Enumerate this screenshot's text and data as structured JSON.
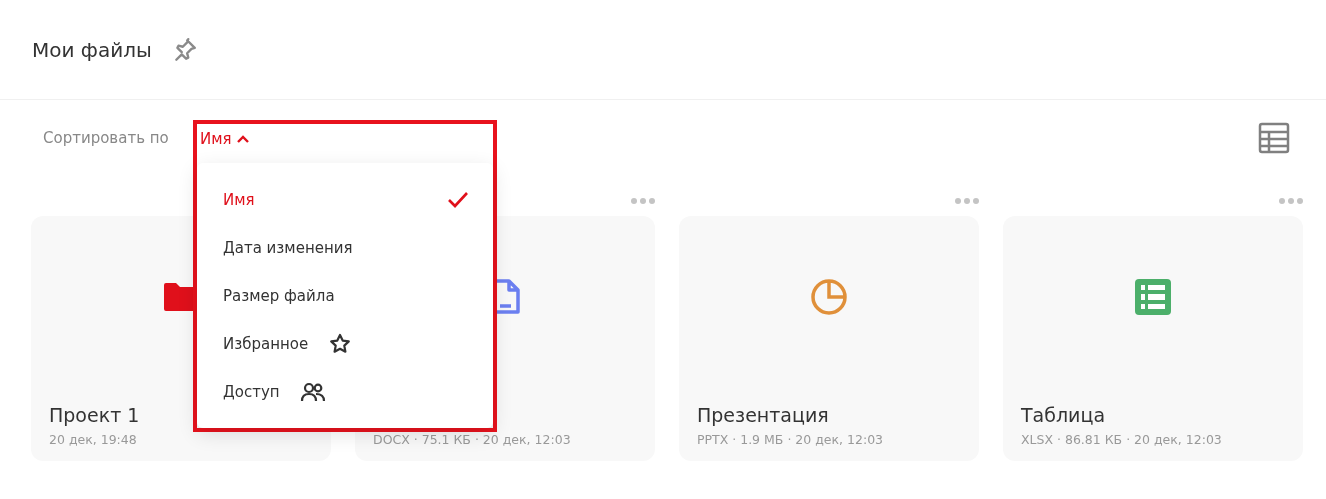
{
  "header": {
    "title": "Мои файлы",
    "pinned": false
  },
  "sort": {
    "label": "Сортировать по",
    "current": "Имя",
    "expanded": true
  },
  "sort_menu": [
    {
      "label": "Имя",
      "selected": true,
      "kind": "plain"
    },
    {
      "label": "Дата изменения",
      "selected": false,
      "kind": "plain"
    },
    {
      "label": "Размер файла",
      "selected": false,
      "kind": "plain"
    },
    {
      "label": "Избранное",
      "selected": false,
      "kind": "star"
    },
    {
      "label": "Доступ",
      "selected": false,
      "kind": "people"
    }
  ],
  "files": [
    {
      "kind": "folder",
      "name": "Проект 1",
      "meta": "20 дек, 19:48",
      "color": "#e0101b"
    },
    {
      "kind": "document",
      "meta": "DOCX · 75.1 КБ · 20 дек, 12:03",
      "color": "#6b7ff0"
    },
    {
      "kind": "presentation",
      "name": "Презентация",
      "meta": "PPTX · 1.9 МБ · 20 дек, 12:03",
      "color": "#e0903a"
    },
    {
      "kind": "spreadsheet",
      "name": "Таблица",
      "meta": "XLSX · 86.81 КБ · 20 дек, 12:03",
      "color": "#4caf6a"
    }
  ]
}
